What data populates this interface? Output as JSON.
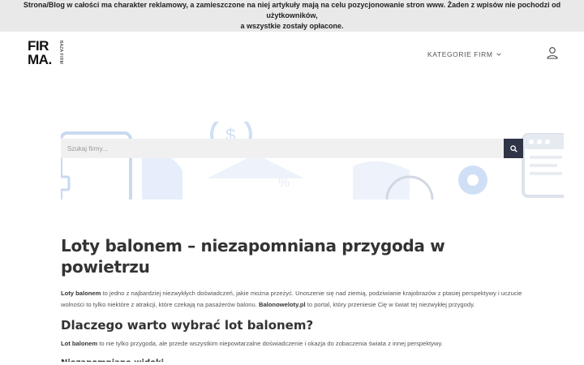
{
  "notice": {
    "line1": "Strona/Blog w całości ma charakter reklamowy, a zamieszczone na niej artykuły mają na celu pozycjonowanie stron www. Żaden z wpisów nie pochodzi od użytkowników,",
    "line2": "a wszystkie zostały opłacone."
  },
  "header": {
    "logo_text_1": "FIR",
    "logo_text_2": "MA.",
    "logo_sub": "BAZA FIRM",
    "nav_category": "KATEGORIE FIRM"
  },
  "search": {
    "placeholder": "Szukaj firmy..."
  },
  "article": {
    "title": "Loty balonem – niezapomniana przygoda w powietrzu",
    "intro_bold": "Loty balonem",
    "intro_text_1": " to jedno z najbardziej niezwykłych doświadczeń, jakie można przeżyć. Unoszenie się nad ziemią, podziwianie krajobrazów z ptasiej perspektywy i uczucie wolności to tylko niektóre z atrakcji, które czekają na pasażerów balonu. ",
    "intro_link": "Balonoweloty.pl",
    "intro_text_2": " to portal, który przeniesie Cię w świat tej niezwykłej przygody.",
    "section_heading": "Dlaczego warto wybrać lot balonem?",
    "section_bold": "Lot balonem",
    "section_text": " to nie tylko przygoda, ale przede wszystkim niepowtarzalne doświadczenie i okazja do zobaczenia świata z innej perspektywy.",
    "next_heading": "Niezapomniane widoki"
  },
  "colors": {
    "search_button": "#2f3547",
    "notice_bg": "#e9e9e9",
    "hero_accent": "#4a90e2"
  }
}
